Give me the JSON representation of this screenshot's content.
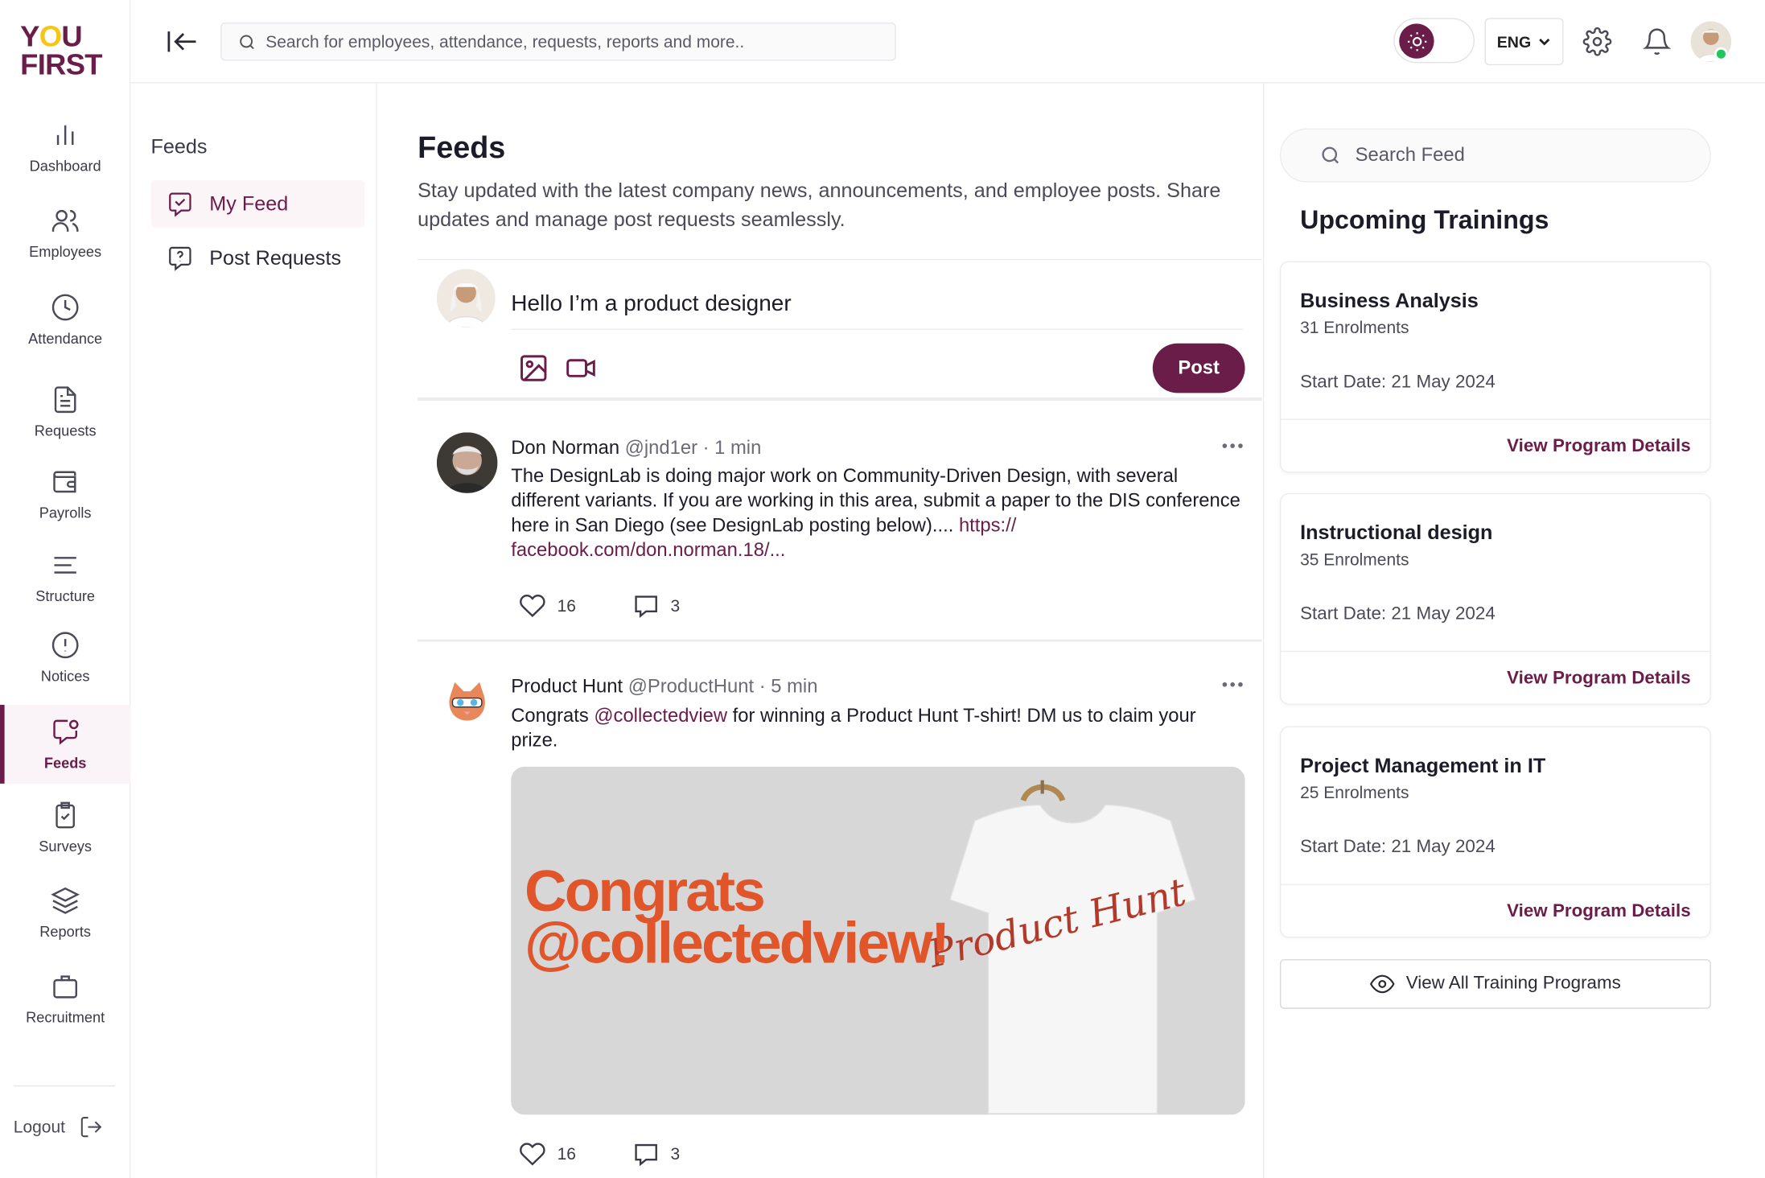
{
  "brand": {
    "logo_line1": "YOU",
    "logo_line2": "FIRST",
    "accent": "#6b1d4a",
    "logo_o": "#f5c518"
  },
  "topbar": {
    "search_placeholder": "Search for employees, attendance, requests, reports and more..",
    "language": "ENG",
    "icons": [
      "collapse-sidebar-icon",
      "search-icon",
      "sun-icon",
      "chevron-down-icon",
      "gear-icon",
      "bell-icon"
    ]
  },
  "sidebar": {
    "items": [
      {
        "label": "Dashboard",
        "icon": "bar-chart-icon"
      },
      {
        "label": "Employees",
        "icon": "users-icon"
      },
      {
        "label": "Attendance",
        "icon": "clock-icon"
      },
      {
        "label": "Requests",
        "icon": "document-icon"
      },
      {
        "label": "Payrolls",
        "icon": "wallet-icon"
      },
      {
        "label": "Structure",
        "icon": "lines-icon"
      },
      {
        "label": "Notices",
        "icon": "alert-circle-icon"
      },
      {
        "label": "Feeds",
        "icon": "chat-bubble-icon",
        "active": true
      },
      {
        "label": "Surveys",
        "icon": "clipboard-check-icon"
      },
      {
        "label": "Reports",
        "icon": "layers-icon"
      },
      {
        "label": "Recruitment",
        "icon": "briefcase-icon"
      }
    ],
    "logout_label": "Logout"
  },
  "subnav": {
    "title": "Feeds",
    "items": [
      {
        "label": "My Feed",
        "icon": "chat-check-icon",
        "active": true
      },
      {
        "label": "Post Requests",
        "icon": "chat-question-icon"
      }
    ]
  },
  "main": {
    "title": "Feeds",
    "description": "Stay updated with the latest company news, announcements, and employee posts. Share updates and manage post requests seamlessly.",
    "composer": {
      "value": "Hello I’m a product designer",
      "post_label": "Post"
    },
    "posts": [
      {
        "author": "Don Norman",
        "handle": "@jnd1er",
        "time": "· 1 min",
        "body": "The DesignLab is doing major work on Community-Driven Design, with several different variants. If you are working in this area, submit a paper to the DIS conference here in San Diego (see DesignLab posting below)....",
        "link": "https:// facebook.com/don.norman.18/...",
        "likes": "16",
        "comments": "3"
      },
      {
        "author": "Product Hunt",
        "handle": "@ProductHunt",
        "time": "· 5 min",
        "body_prefix": "Congrats",
        "mention": "@collectedview",
        "body_suffix": "for winning a Product Hunt T-shirt! DM us to claim your prize.",
        "image_text_1": "Congrats",
        "image_text_2": "@collectedview!",
        "shirt_text": "Product Hunt",
        "likes": "16",
        "comments": "3"
      }
    ]
  },
  "right": {
    "search_placeholder": "Search Feed",
    "trainings_title": "Upcoming Trainings",
    "trainings": [
      {
        "name": "Business Analysis",
        "enrolments": "31 Enrolments",
        "start": "Start Date: 21 May 2024",
        "link": "View Program Details"
      },
      {
        "name": "Instructional design",
        "enrolments": "35 Enrolments",
        "start": "Start Date: 21 May 2024",
        "link": "View Program Details"
      },
      {
        "name": "Project Management in IT",
        "enrolments": "25 Enrolments",
        "start": "Start Date: 21 May 2024",
        "link": "View Program Details"
      }
    ],
    "view_all_label": "View All Training Programs"
  }
}
